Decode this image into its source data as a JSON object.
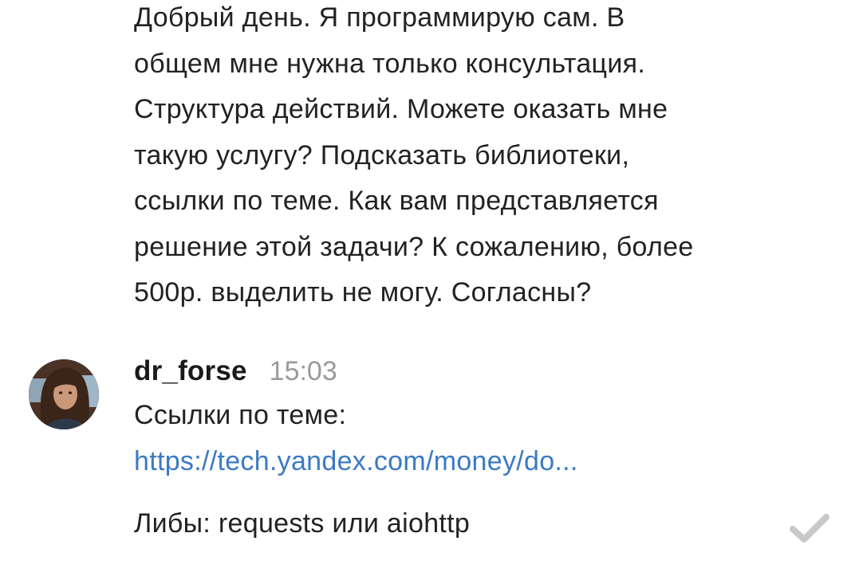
{
  "previous_message": {
    "text": "Добрый день. Я программирую сам. В\nобщем мне нужна только консультация.\nСтруктура действий. Можете оказать мне\nтакую услугу? Подсказать библиотеки,\nссылки по теме. Как вам представляется\nрешение этой задачи? К сожалению, более\n500р. выделить не могу. Согласны?"
  },
  "message": {
    "author": "dr_forse",
    "time": "15:03",
    "links_label": "Ссылки по теме:",
    "link_text": "https://tech.yandex.com/money/do...",
    "libs_text": "Либы: requests или aiohttp",
    "status_icon": "checkmark-icon"
  },
  "colors": {
    "link": "#3a7ac4",
    "timestamp": "#9a9a9a",
    "text": "#222222",
    "checkmark": "#c8c8c8"
  }
}
